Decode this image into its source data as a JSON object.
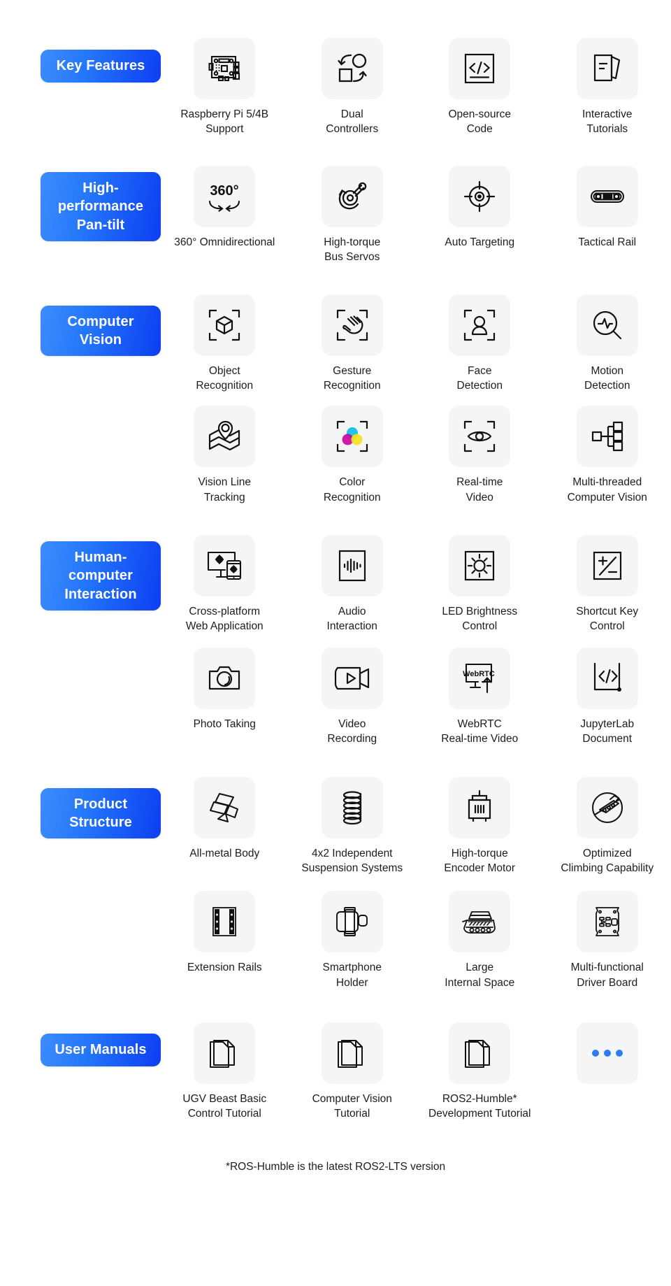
{
  "colors": {
    "badge_gradient_start": "#3e8cfb",
    "badge_gradient_end": "#0d3ef2",
    "tile_bg": "#f5f5f5",
    "text": "#1d1d1f",
    "dot_blue": "#2b7cf6",
    "cmyk_cyan": "#17c0e9",
    "cmyk_magenta": "#c4009b",
    "cmyk_yellow": "#f5e21a"
  },
  "sections": [
    {
      "badge": "Key Features",
      "rows": [
        [
          {
            "icon": "raspberry-pi-board-icon",
            "label": "Raspberry Pi 5/4B\nSupport"
          },
          {
            "icon": "dual-controllers-icon",
            "label": "Dual\nControllers"
          },
          {
            "icon": "open-source-code-icon",
            "label": "Open-source\nCode"
          },
          {
            "icon": "interactive-tutorials-icon",
            "label": "Interactive\nTutorials"
          }
        ]
      ]
    },
    {
      "badge": "High-performance\nPan-tilt",
      "rows": [
        [
          {
            "icon": "360-degree-rotation-icon",
            "label": "360° Omnidirectional"
          },
          {
            "icon": "bus-servo-icon",
            "label": "High-torque\nBus Servos"
          },
          {
            "icon": "auto-targeting-crosshair-icon",
            "label": "Auto Targeting"
          },
          {
            "icon": "tactical-rail-icon",
            "label": "Tactical Rail"
          }
        ]
      ]
    },
    {
      "badge": "Computer Vision",
      "rows": [
        [
          {
            "icon": "object-recognition-cube-icon",
            "label": "Object\nRecognition"
          },
          {
            "icon": "gesture-hand-icon",
            "label": "Gesture\nRecognition"
          },
          {
            "icon": "face-detection-person-icon",
            "label": "Face\nDetection"
          },
          {
            "icon": "motion-detection-pulse-icon",
            "label": "Motion\nDetection"
          }
        ],
        [
          {
            "icon": "vision-line-tracking-map-icon",
            "label": "Vision Line\nTracking"
          },
          {
            "icon": "color-recognition-cmyk-icon",
            "label": "Color\nRecognition"
          },
          {
            "icon": "realtime-video-eye-icon",
            "label": "Real-time\nVideo"
          },
          {
            "icon": "multi-threaded-tree-icon",
            "label": "Multi-threaded\nComputer Vision"
          }
        ]
      ]
    },
    {
      "badge": "Human-computer\nInteraction",
      "rows": [
        [
          {
            "icon": "cross-platform-devices-icon",
            "label": "Cross-platform\nWeb Application"
          },
          {
            "icon": "audio-waveform-icon",
            "label": "Audio\nInteraction"
          },
          {
            "icon": "led-brightness-sun-icon",
            "label": "LED Brightness\nControl"
          },
          {
            "icon": "shortcut-key-plus-minus-icon",
            "label": "Shortcut Key\nControl"
          }
        ],
        [
          {
            "icon": "photo-camera-icon",
            "label": "Photo Taking"
          },
          {
            "icon": "video-recording-camcorder-icon",
            "label": "Video\nRecording"
          },
          {
            "icon": "webrtc-upload-icon",
            "label": "WebRTC\nReal-time Video"
          },
          {
            "icon": "jupyterlab-code-icon",
            "label": "JupyterLab\nDocument"
          }
        ]
      ]
    },
    {
      "badge": "Product Structure",
      "rows": [
        [
          {
            "icon": "metal-ingots-icon",
            "label": "All-metal Body"
          },
          {
            "icon": "suspension-spring-icon",
            "label": "4x2 Independent\nSuspension Systems"
          },
          {
            "icon": "encoder-motor-icon",
            "label": "High-torque\nEncoder Motor"
          },
          {
            "icon": "climbing-capability-icon",
            "label": "Optimized\nClimbing Capability"
          }
        ],
        [
          {
            "icon": "extension-rails-icon",
            "label": "Extension Rails"
          },
          {
            "icon": "smartphone-holder-icon",
            "label": "Smartphone\nHolder"
          },
          {
            "icon": "large-internal-space-icon",
            "label": "Large\nInternal Space"
          },
          {
            "icon": "driver-board-icon",
            "label": "Multi-functional\nDriver Board"
          }
        ]
      ]
    },
    {
      "badge": "User Manuals",
      "rows": [
        [
          {
            "icon": "document-pages-icon",
            "label": "UGV Beast Basic\nControl Tutorial"
          },
          {
            "icon": "document-pages-icon",
            "label": "Computer Vision\nTutorial"
          },
          {
            "icon": "document-pages-icon",
            "label": "ROS2-Humble*\nDevelopment Tutorial"
          },
          {
            "icon": "more-dots-icon",
            "label": ""
          }
        ]
      ]
    }
  ],
  "footnote": "*ROS-Humble is the latest ROS2-LTS version"
}
